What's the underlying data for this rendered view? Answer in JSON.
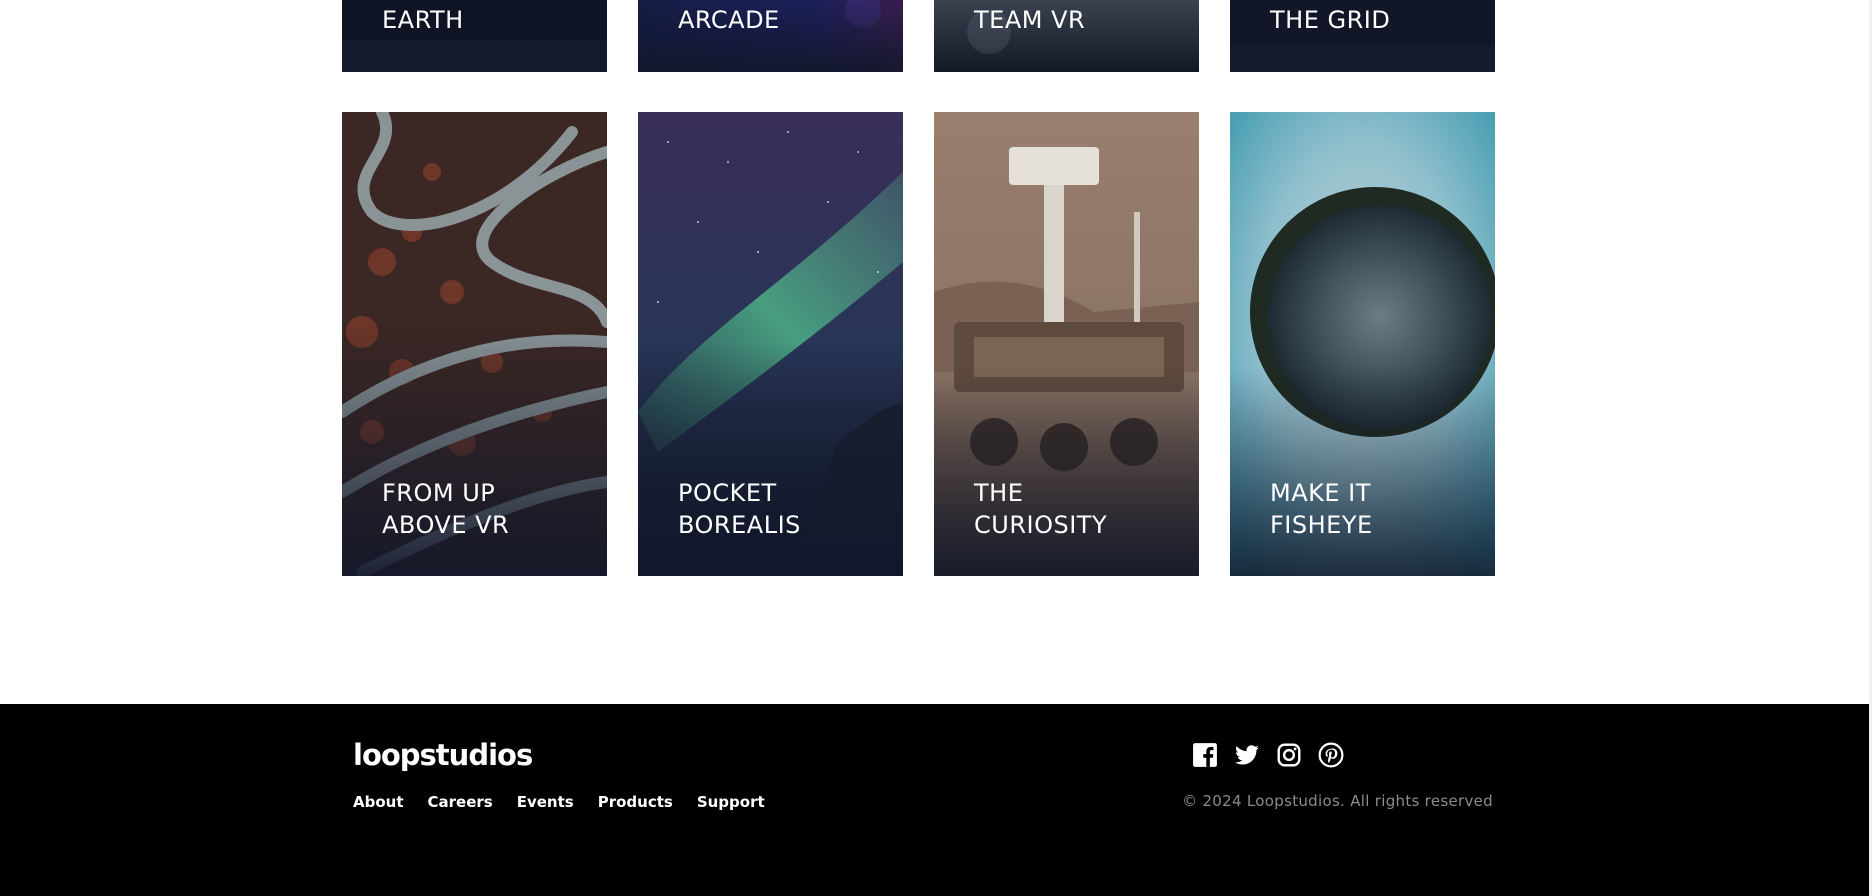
{
  "creations": {
    "cards_top": [
      {
        "title": "Earth"
      },
      {
        "title": "Arcade"
      },
      {
        "title": "Team VR"
      },
      {
        "title": "The Grid"
      }
    ],
    "cards": [
      {
        "title": "From up\nabove VR",
        "image": "winding-roads-aerial"
      },
      {
        "title": "Pocket\nborealis",
        "image": "aurora-night-sky"
      },
      {
        "title": "The\ncuriosity",
        "image": "mars-rover"
      },
      {
        "title": "Make it\nfisheye",
        "image": "fisheye-planet"
      }
    ]
  },
  "footer": {
    "logo": "loopstudios",
    "nav": [
      "About",
      "Careers",
      "Events",
      "Products",
      "Support"
    ],
    "social": [
      "facebook-icon",
      "twitter-icon",
      "instagram-icon",
      "pinterest-icon"
    ],
    "copyright": "© 2024 Loopstudios. All rights reserved"
  },
  "colors": {
    "footer_bg": "#000000",
    "card_overlay": "#11172a",
    "copyright_text": "#8a8a93"
  }
}
